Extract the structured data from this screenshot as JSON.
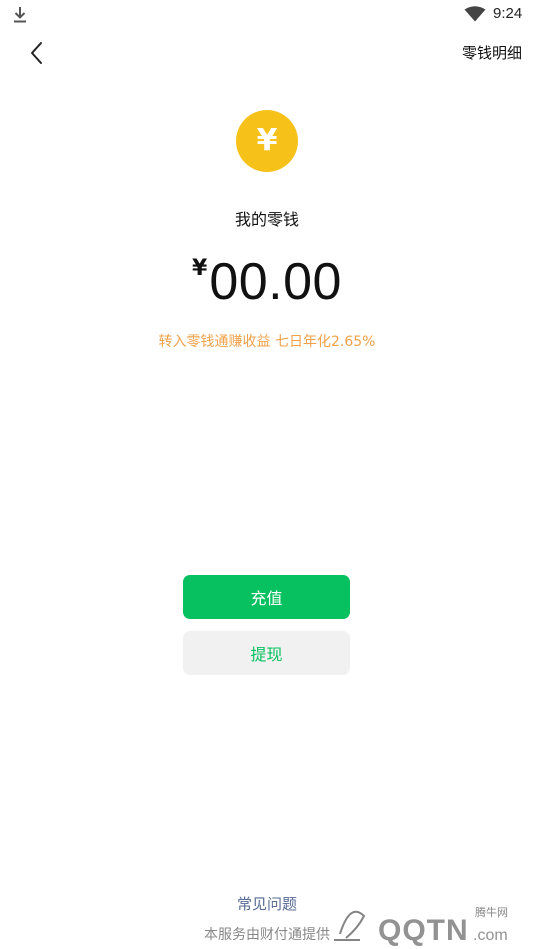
{
  "status_bar": {
    "time": "9:24",
    "left_icon": "download-icon",
    "right_icon": "wifi-icon"
  },
  "nav": {
    "back_icon": "chevron-left-icon",
    "right_link": "零钱明细"
  },
  "wallet": {
    "coin_icon": "yuan-coin-icon",
    "coin_glyph": "¥",
    "title": "我的零钱",
    "currency_symbol": "¥",
    "amount": "00.00",
    "promo": "转入零钱通赚收益 七日年化2.65%"
  },
  "actions": {
    "topup_label": "充值",
    "withdraw_label": "提现"
  },
  "footer": {
    "faq_link": "常见问题",
    "provider": "本服务由财付通提供"
  },
  "watermark": {
    "text_small": "腾牛网",
    "text_large": "QQTN.com"
  },
  "colors": {
    "primary_green": "#07c160",
    "coin_yellow": "#f6c21a",
    "promo_orange": "#f0a14a",
    "link_blue": "#576b95",
    "withdraw_bg": "#f1f1f1"
  }
}
